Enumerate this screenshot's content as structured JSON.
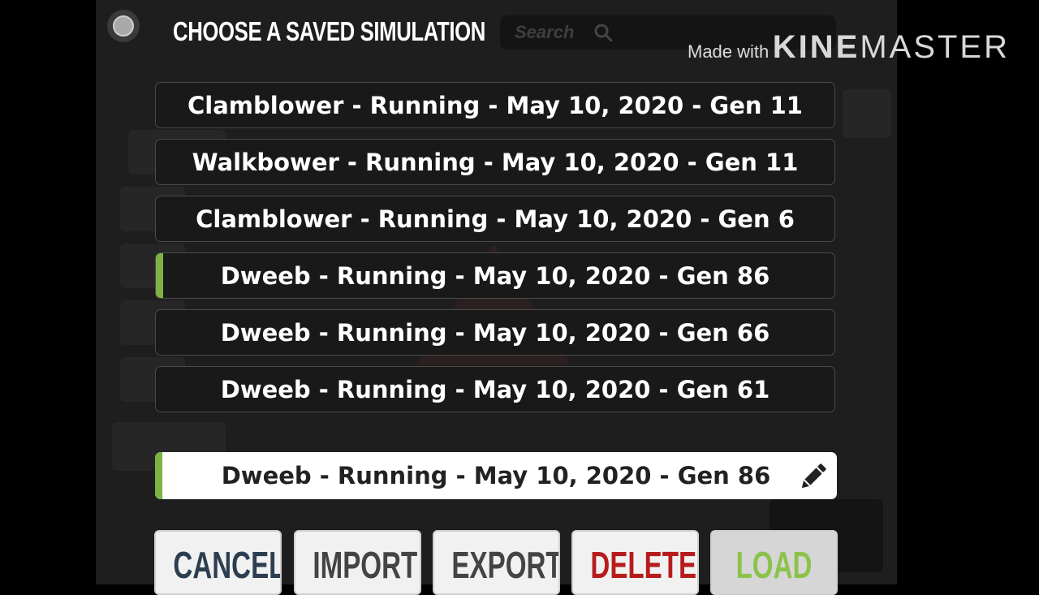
{
  "dialog": {
    "title": "CHOOSE A SAVED SIMULATION",
    "search_placeholder": "Search"
  },
  "watermark": {
    "made_with": "Made with",
    "kine": "KINE",
    "master": "MASTER"
  },
  "simulations": [
    {
      "label": "Clamblower - Running - May 10, 2020 - Gen 11",
      "active": false
    },
    {
      "label": "Walkbower - Running - May 10, 2020 - Gen 11",
      "active": false
    },
    {
      "label": "Clamblower - Running - May 10, 2020 - Gen 6",
      "active": false
    },
    {
      "label": "Dweeb - Running - May 10, 2020 - Gen 86",
      "active": true
    },
    {
      "label": "Dweeb - Running - May 10, 2020 - Gen 66",
      "active": false
    },
    {
      "label": "Dweeb - Running - May 10, 2020 - Gen 61",
      "active": false
    }
  ],
  "selected_name": "Dweeb - Running - May 10, 2020 - Gen 86",
  "buttons": {
    "cancel": "CANCEL",
    "import": "IMPORT",
    "export": "EXPORT",
    "delete": "DELETE",
    "load": "LOAD"
  },
  "colors": {
    "accent": "#7cb342",
    "cancel": "#2c3e50",
    "import": "#444444",
    "export": "#444444",
    "delete": "#b71c1c",
    "load": "#8bc34a"
  },
  "icons": {
    "search": "search-icon",
    "edit": "pencil-icon",
    "radio": "radio-indicator-icon"
  }
}
